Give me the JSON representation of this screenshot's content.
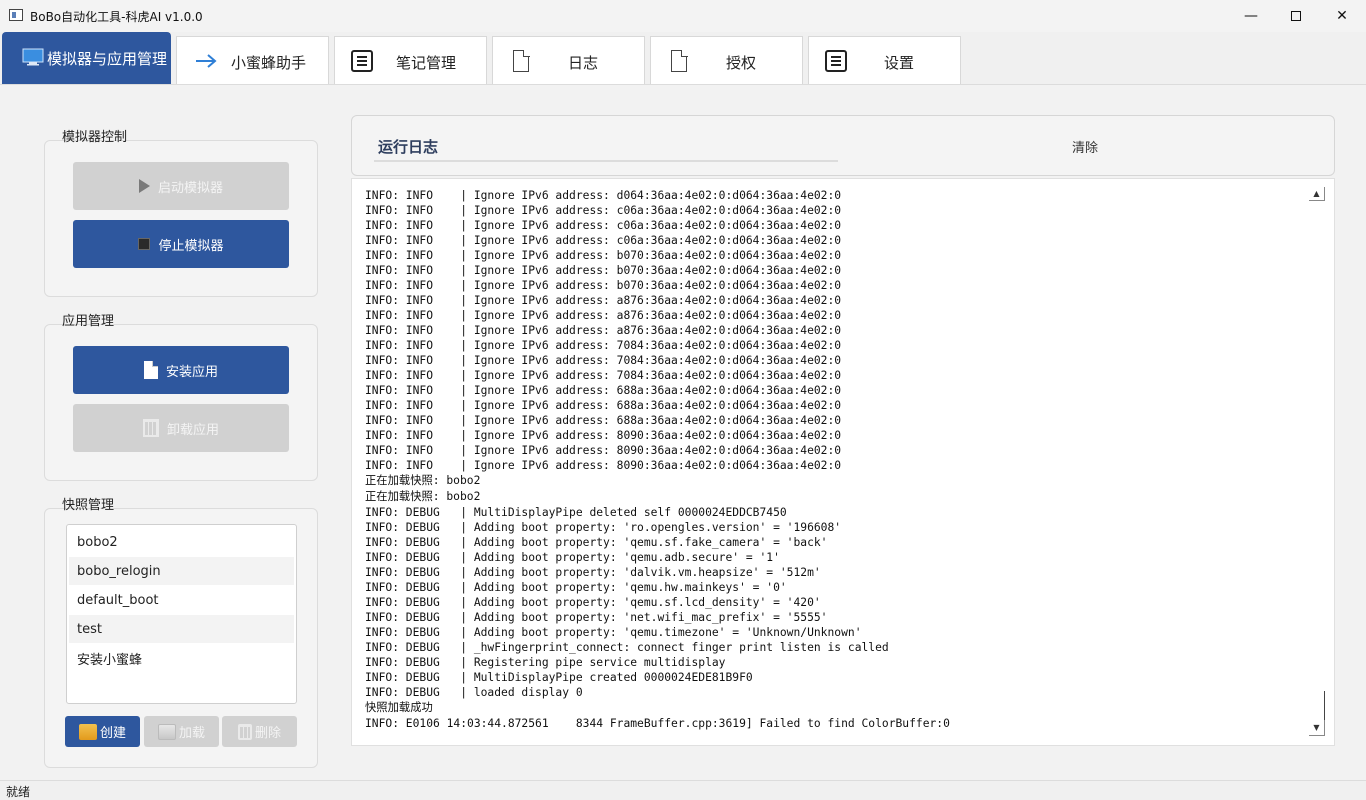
{
  "window": {
    "title": "BoBo自动化工具-科虎AI v1.0.0",
    "min_glyph": "—",
    "close_glyph": "✕"
  },
  "tabs": [
    {
      "label": "模拟器与应用管理",
      "icon": "monitor-icon",
      "active": true
    },
    {
      "label": "小蜜蜂助手",
      "icon": "arrow-right-icon",
      "active": false
    },
    {
      "label": "笔记管理",
      "icon": "list-icon",
      "active": false
    },
    {
      "label": "日志",
      "icon": "document-icon",
      "active": false
    },
    {
      "label": "授权",
      "icon": "document-icon",
      "active": false
    },
    {
      "label": "设置",
      "icon": "list-icon",
      "active": false
    }
  ],
  "emulator_group": {
    "title": "模拟器控制",
    "start_label": "启动模拟器",
    "stop_label": "停止模拟器"
  },
  "app_group": {
    "title": "应用管理",
    "install_label": "安装应用",
    "uninstall_label": "卸载应用"
  },
  "snapshot_group": {
    "title": "快照管理",
    "items": [
      "bobo2",
      "bobo_relogin",
      "default_boot",
      "test",
      "安装小蜜蜂"
    ],
    "create_label": "创建",
    "load_label": "加载",
    "delete_label": "删除"
  },
  "log_panel": {
    "title": "运行日志",
    "clear_label": "清除",
    "lines": [
      "INFO: INFO    | Ignore IPv6 address: d064:36aa:4e02:0:d064:36aa:4e02:0",
      "INFO: INFO    | Ignore IPv6 address: c06a:36aa:4e02:0:d064:36aa:4e02:0",
      "INFO: INFO    | Ignore IPv6 address: c06a:36aa:4e02:0:d064:36aa:4e02:0",
      "INFO: INFO    | Ignore IPv6 address: c06a:36aa:4e02:0:d064:36aa:4e02:0",
      "INFO: INFO    | Ignore IPv6 address: b070:36aa:4e02:0:d064:36aa:4e02:0",
      "INFO: INFO    | Ignore IPv6 address: b070:36aa:4e02:0:d064:36aa:4e02:0",
      "INFO: INFO    | Ignore IPv6 address: b070:36aa:4e02:0:d064:36aa:4e02:0",
      "INFO: INFO    | Ignore IPv6 address: a876:36aa:4e02:0:d064:36aa:4e02:0",
      "INFO: INFO    | Ignore IPv6 address: a876:36aa:4e02:0:d064:36aa:4e02:0",
      "INFO: INFO    | Ignore IPv6 address: a876:36aa:4e02:0:d064:36aa:4e02:0",
      "INFO: INFO    | Ignore IPv6 address: 7084:36aa:4e02:0:d064:36aa:4e02:0",
      "INFO: INFO    | Ignore IPv6 address: 7084:36aa:4e02:0:d064:36aa:4e02:0",
      "INFO: INFO    | Ignore IPv6 address: 7084:36aa:4e02:0:d064:36aa:4e02:0",
      "INFO: INFO    | Ignore IPv6 address: 688a:36aa:4e02:0:d064:36aa:4e02:0",
      "INFO: INFO    | Ignore IPv6 address: 688a:36aa:4e02:0:d064:36aa:4e02:0",
      "INFO: INFO    | Ignore IPv6 address: 688a:36aa:4e02:0:d064:36aa:4e02:0",
      "INFO: INFO    | Ignore IPv6 address: 8090:36aa:4e02:0:d064:36aa:4e02:0",
      "INFO: INFO    | Ignore IPv6 address: 8090:36aa:4e02:0:d064:36aa:4e02:0",
      "INFO: INFO    | Ignore IPv6 address: 8090:36aa:4e02:0:d064:36aa:4e02:0",
      "正在加载快照: bobo2",
      "正在加载快照: bobo2",
      "INFO: DEBUG   | MultiDisplayPipe deleted self 0000024EDDCB7450",
      "INFO: DEBUG   | Adding boot property: 'ro.opengles.version' = '196608'",
      "INFO: DEBUG   | Adding boot property: 'qemu.sf.fake_camera' = 'back'",
      "INFO: DEBUG   | Adding boot property: 'qemu.adb.secure' = '1'",
      "INFO: DEBUG   | Adding boot property: 'dalvik.vm.heapsize' = '512m'",
      "INFO: DEBUG   | Adding boot property: 'qemu.hw.mainkeys' = '0'",
      "INFO: DEBUG   | Adding boot property: 'qemu.sf.lcd_density' = '420'",
      "INFO: DEBUG   | Adding boot property: 'net.wifi_mac_prefix' = '5555'",
      "INFO: DEBUG   | Adding boot property: 'qemu.timezone' = 'Unknown/Unknown'",
      "INFO: DEBUG   | _hwFingerprint_connect: connect finger print listen is called",
      "INFO: DEBUG   | Registering pipe service multidisplay",
      "INFO: DEBUG   | MultiDisplayPipe created 0000024EDE81B9F0",
      "INFO: DEBUG   | loaded display 0",
      "快照加载成功",
      "INFO: E0106 14:03:44.872561    8344 FrameBuffer.cpp:3619] Failed to find ColorBuffer:0"
    ]
  },
  "status_bar": {
    "text": "就绪"
  },
  "colors": {
    "accent": "#2e579e",
    "disabled": "#d1d1d1"
  }
}
